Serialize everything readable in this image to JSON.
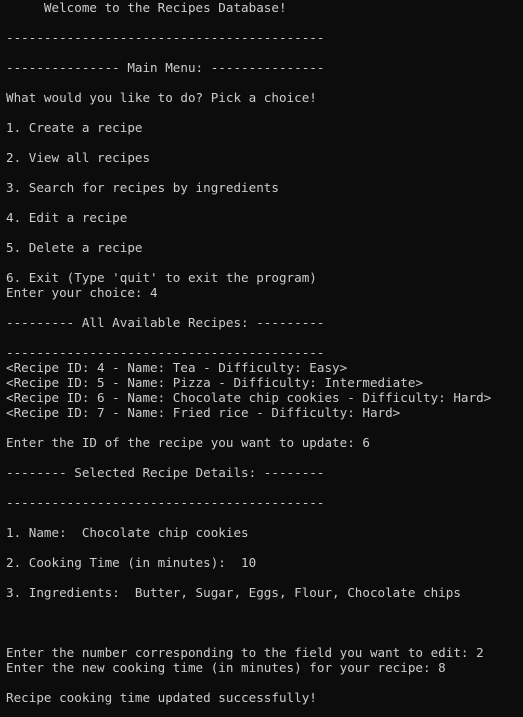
{
  "terminal": {
    "lines": [
      "     Welcome to the Recipes Database!",
      "",
      "------------------------------------------",
      "",
      "--------------- Main Menu: ---------------",
      "",
      "What would you like to do? Pick a choice!",
      "",
      "1. Create a recipe",
      "",
      "2. View all recipes",
      "",
      "3. Search for recipes by ingredients",
      "",
      "4. Edit a recipe",
      "",
      "5. Delete a recipe",
      "",
      "6. Exit (Type 'quit' to exit the program)",
      "Enter your choice: 4",
      "",
      "--------- All Available Recipes: ---------",
      "",
      "------------------------------------------",
      "<Recipe ID: 4 - Name: Tea - Difficulty: Easy>",
      "<Recipe ID: 5 - Name: Pizza - Difficulty: Intermediate>",
      "<Recipe ID: 6 - Name: Chocolate chip cookies - Difficulty: Hard>",
      "<Recipe ID: 7 - Name: Fried rice - Difficulty: Hard>",
      "",
      "Enter the ID of the recipe you want to update: 6",
      "",
      "-------- Selected Recipe Details: --------",
      "",
      "------------------------------------------",
      "",
      "1. Name:  Chocolate chip cookies",
      "",
      "2. Cooking Time (in minutes):  10",
      "",
      "3. Ingredients:  Butter, Sugar, Eggs, Flour, Chocolate chips",
      "",
      "",
      "",
      "Enter the number corresponding to the field you want to edit: 2",
      "Enter the new cooking time (in minutes) for your recipe: 8",
      "",
      "Recipe cooking time updated successfully!"
    ]
  }
}
